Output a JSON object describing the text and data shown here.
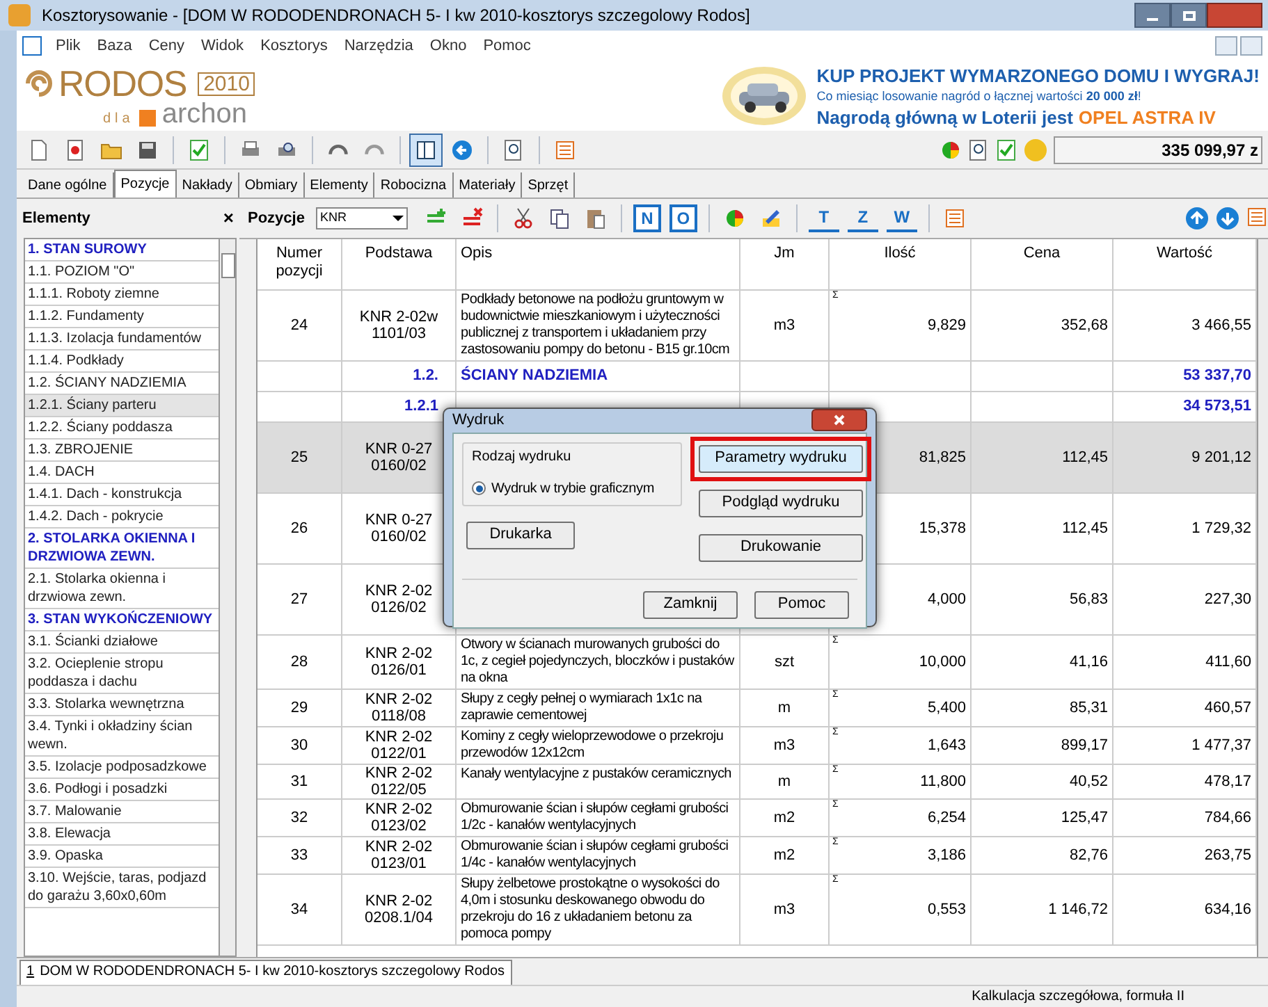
{
  "window": {
    "title": "Kosztorysowanie - [DOM W RODODENDRONACH 5- I kw 2010-kosztorys szczegolowy Rodos]"
  },
  "menu": [
    "Plik",
    "Baza",
    "Ceny",
    "Widok",
    "Kosztorys",
    "Narzędzia",
    "Okno",
    "Pomoc"
  ],
  "logo": {
    "name": "RODOS",
    "year": "2010",
    "dla": "dla",
    "brand": "archon"
  },
  "ad": {
    "headline": "KUP PROJEKT WYMARZONEGO DOMU I WYGRAJ!",
    "line": "Co miesiąc losowanie nagród o łącznej wartości **20 000 zł**!",
    "prize": "Nagrodą główną w Loterii jest",
    "prize_highlight": "OPEL ASTRA IV"
  },
  "main_toolbar": [
    {
      "kind": "new",
      "pressed": false
    },
    {
      "kind": "star",
      "pressed": false
    },
    {
      "kind": "open",
      "pressed": false
    },
    {
      "kind": "save",
      "pressed": false
    },
    {
      "kind": "sep"
    },
    {
      "kind": "check",
      "pressed": false
    },
    {
      "kind": "sep"
    },
    {
      "kind": "print",
      "pressed": false
    },
    {
      "kind": "preview",
      "pressed": false
    },
    {
      "kind": "sep"
    },
    {
      "kind": "undo",
      "pressed": false
    },
    {
      "kind": "redo",
      "pressed": false
    },
    {
      "kind": "sep"
    },
    {
      "kind": "panels",
      "pressed": true
    },
    {
      "kind": "back",
      "pressed": false
    },
    {
      "kind": "sep"
    },
    {
      "kind": "zoom",
      "pressed": false
    },
    {
      "kind": "sep"
    },
    {
      "kind": "list",
      "pressed": false
    }
  ],
  "total": "335 099,97 z",
  "tabs": [
    {
      "label": "Dane ogólne",
      "selected": false
    },
    {
      "label": "Pozycje",
      "selected": true
    },
    {
      "label": "Nakłady",
      "selected": false
    },
    {
      "label": "Obmiary",
      "selected": false
    },
    {
      "label": "Elementy",
      "selected": false
    },
    {
      "label": "Robocizna",
      "selected": false
    },
    {
      "label": "Materiały",
      "selected": false
    },
    {
      "label": "Sprzęt",
      "selected": false
    }
  ],
  "sidebar": {
    "title": "Elementy",
    "close": "×",
    "items": [
      {
        "label": "1. STAN SUROWY",
        "kind": "heading",
        "selected": false
      },
      {
        "label": "1.1. POZIOM \"O\"",
        "kind": "item",
        "selected": false
      },
      {
        "label": "1.1.1. Roboty ziemne",
        "kind": "item",
        "selected": false
      },
      {
        "label": "1.1.2. Fundamenty",
        "kind": "item",
        "selected": false
      },
      {
        "label": "1.1.3. Izolacja fundamentów",
        "kind": "item",
        "selected": false
      },
      {
        "label": "1.1.4. Podkłady",
        "kind": "item",
        "selected": false
      },
      {
        "label": "1.2. ŚCIANY NADZIEMIA",
        "kind": "item",
        "selected": false
      },
      {
        "label": "1.2.1. Ściany parteru",
        "kind": "item",
        "selected": true
      },
      {
        "label": "1.2.2. Ściany poddasza",
        "kind": "item",
        "selected": false
      },
      {
        "label": "1.3. ZBROJENIE",
        "kind": "item",
        "selected": false
      },
      {
        "label": "1.4. DACH",
        "kind": "item",
        "selected": false
      },
      {
        "label": "1.4.1. Dach - konstrukcja",
        "kind": "item",
        "selected": false
      },
      {
        "label": "1.4.2. Dach - pokrycie",
        "kind": "item",
        "selected": false
      },
      {
        "label": "2. STOLARKA OKIENNA I DRZWIOWA ZEWN.",
        "kind": "heading",
        "selected": false
      },
      {
        "label": "2.1. Stolarka okienna i drzwiowa zewn.",
        "kind": "item",
        "selected": false
      },
      {
        "label": "3. STAN WYKOŃCZENIOWY",
        "kind": "heading",
        "selected": false
      },
      {
        "label": "3.1. Ścianki działowe",
        "kind": "item",
        "selected": false
      },
      {
        "label": "3.2. Ocieplenie stropu poddasza i dachu",
        "kind": "item",
        "selected": false
      },
      {
        "label": "3.3. Stolarka wewnętrzna",
        "kind": "item",
        "selected": false
      },
      {
        "label": "3.4. Tynki i okładziny ścian wewn.",
        "kind": "item",
        "selected": false
      },
      {
        "label": "3.5. Izolacje podposadzkowe",
        "kind": "item",
        "selected": false
      },
      {
        "label": "3.6. Podłogi i posadzki",
        "kind": "item",
        "selected": false
      },
      {
        "label": "3.7. Malowanie",
        "kind": "item",
        "selected": false
      },
      {
        "label": "3.8. Elewacja",
        "kind": "item",
        "selected": false
      },
      {
        "label": "3.9. Opaska",
        "kind": "item",
        "selected": false
      },
      {
        "label": "3.10. Wejście,  taras, podjazd do garażu 3,60x0,60m",
        "kind": "item",
        "selected": false
      }
    ]
  },
  "positions_toolbar": {
    "label": "Pozycje",
    "catalog": "KNR",
    "buttons": [
      {
        "kind": "add"
      },
      {
        "kind": "delete"
      },
      {
        "kind": "sep"
      },
      {
        "kind": "cut"
      },
      {
        "kind": "copy"
      },
      {
        "kind": "paste"
      },
      {
        "kind": "sep"
      },
      {
        "kind": "letter",
        "glyph": "N"
      },
      {
        "kind": "letter",
        "glyph": "O"
      },
      {
        "kind": "sep"
      },
      {
        "kind": "pie"
      },
      {
        "kind": "edit"
      },
      {
        "kind": "sep"
      },
      {
        "kind": "underline",
        "glyph": "T"
      },
      {
        "kind": "underline",
        "glyph": "Z"
      },
      {
        "kind": "underline",
        "glyph": "W"
      },
      {
        "kind": "sep"
      },
      {
        "kind": "list"
      }
    ]
  },
  "table": {
    "columns": [
      "Numer pozycji",
      "Podstawa",
      "Opis",
      "Jm",
      "Ilość",
      "Cena",
      "Wartość"
    ],
    "rows": [
      {
        "kind": "position",
        "number": "24",
        "basis": "KNR 2-02w\n1101/03",
        "description": "Podkłady betonowe na podłożu gruntowym w budownictwie mieszkaniowym i użyteczności publicznej z transportem i układaniem przy zastosowaniu pompy do betonu - B15 gr.10cm",
        "unit": "m3",
        "sigma": "Σ",
        "quantity": "9,829",
        "price": "352,68",
        "value": "3 466,55",
        "selected": false
      },
      {
        "kind": "section",
        "code": "1.2.",
        "title": "ŚCIANY NADZIEMIA",
        "value": "53 337,70"
      },
      {
        "kind": "section",
        "code": "1.2.1",
        "value": "34 573,51"
      },
      {
        "kind": "position",
        "number": "25",
        "basis": "KNR 0-27\n0160/02",
        "quantity": "81,825",
        "price": "112,45",
        "value": "9 201,12",
        "selected": true
      },
      {
        "kind": "position",
        "number": "26",
        "basis": "KNR 0-27\n0160/02",
        "quantity": "15,378",
        "price": "112,45",
        "value": "1 729,32",
        "selected": false
      },
      {
        "kind": "position",
        "number": "27",
        "basis": "KNR 2-02\n0126/02",
        "quantity": "4,000",
        "price": "56,83",
        "value": "227,30",
        "selected": false
      },
      {
        "kind": "position",
        "number": "28",
        "basis": "KNR 2-02\n0126/01",
        "description": "Otwory w ścianach murowanych grubości do 1c, z cegieł pojedynczych, bloczków i pustaków na okna",
        "unit": "szt",
        "sigma": "Σ",
        "quantity": "10,000",
        "price": "41,16",
        "value": "411,60",
        "selected": false
      },
      {
        "kind": "position",
        "number": "29",
        "basis": "KNR 2-02\n0118/08",
        "description": "Słupy z cegły pełnej o wymiarach 1x1c na zaprawie cementowej",
        "unit": "m",
        "sigma": "Σ",
        "quantity": "5,400",
        "price": "85,31",
        "value": "460,57",
        "selected": false
      },
      {
        "kind": "position",
        "number": "30",
        "basis": "KNR 2-02\n0122/01",
        "description": "Kominy z cegły wieloprzewodowe o przekroju przewodów 12x12cm",
        "unit": "m3",
        "sigma": "Σ",
        "quantity": "1,643",
        "price": "899,17",
        "value": "1 477,37",
        "selected": false
      },
      {
        "kind": "position",
        "number": "31",
        "basis": "KNR 2-02\n0122/05",
        "description": "Kanały wentylacyjne z pustaków ceramicznych",
        "unit": "m",
        "sigma": "Σ",
        "quantity": "11,800",
        "price": "40,52",
        "value": "478,17",
        "selected": false
      },
      {
        "kind": "position",
        "number": "32",
        "basis": "KNR 2-02\n0123/02",
        "description": "Obmurowanie ścian i słupów cegłami grubości 1/2c - kanałów wentylacyjnych",
        "unit": "m2",
        "sigma": "Σ",
        "quantity": "6,254",
        "price": "125,47",
        "value": "784,66",
        "selected": false
      },
      {
        "kind": "position",
        "number": "33",
        "basis": "KNR 2-02\n0123/01",
        "description": "Obmurowanie ścian i słupów cegłami grubości 1/4c - kanałów wentylacyjnych",
        "unit": "m2",
        "sigma": "Σ",
        "quantity": "3,186",
        "price": "82,76",
        "value": "263,75",
        "selected": false
      },
      {
        "kind": "position",
        "number": "34",
        "basis": "KNR 2-02\n0208.1/04",
        "description": "Słupy żelbetowe prostokątne o wysokości do 4,0m i stosunku deskowanego obwodu do przekroju do 16 z układaniem betonu za pomoca pompy",
        "unit": "m3",
        "sigma": "Σ",
        "quantity": "0,553",
        "price": "1 146,72",
        "value": "634,16",
        "selected": false
      }
    ]
  },
  "dialog": {
    "title": "Wydruk",
    "group": "Rodzaj wydruku",
    "radios": [
      {
        "label": "Wydruk w trybie graficznym",
        "selected": true
      }
    ],
    "buttons": [
      {
        "label": "Parametry wydruku",
        "highlighted": true
      },
      {
        "label": "Podgląd wydruku",
        "highlighted": false
      },
      {
        "label": "Drukarka",
        "highlighted": false
      },
      {
        "label": "Drukowanie",
        "highlighted": false
      },
      {
        "label": "Zamknij",
        "highlighted": false
      },
      {
        "label": "Pomoc",
        "highlighted": false
      }
    ]
  },
  "doc_tab": {
    "index": "1",
    "label": "DOM W RODODENDRONACH 5- I kw 2010-kosztorys szczegolowy Rodos"
  },
  "status_bar": "Kalkulacja szczegółowa, formuła II"
}
